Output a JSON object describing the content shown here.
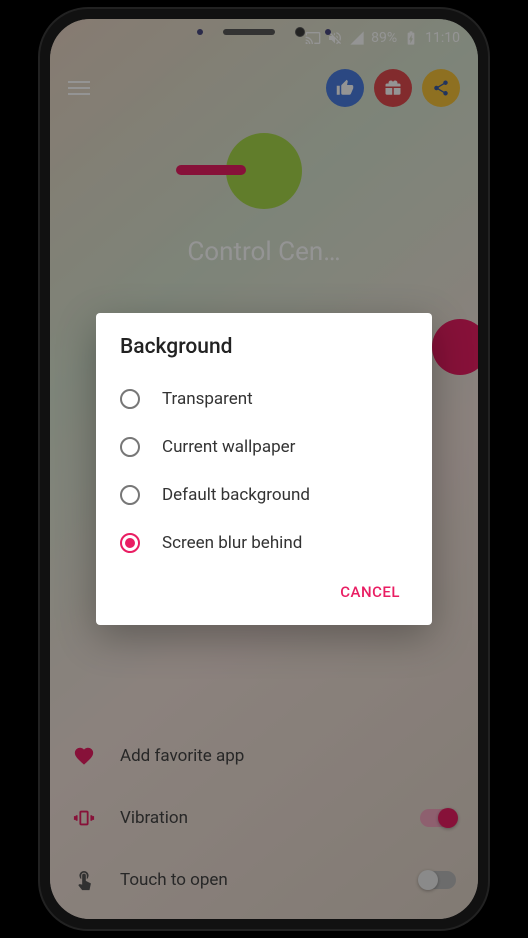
{
  "status": {
    "battery_pct": "89%",
    "time": "11:10"
  },
  "header": {
    "title": "Control Cen…"
  },
  "dialog": {
    "title": "Background",
    "options": [
      {
        "label": "Transparent",
        "selected": false
      },
      {
        "label": "Current wallpaper",
        "selected": false
      },
      {
        "label": "Default background",
        "selected": false
      },
      {
        "label": "Screen blur behind",
        "selected": true
      }
    ],
    "cancel": "CANCEL"
  },
  "list": {
    "items": [
      {
        "label": "Add favorite app",
        "icon": "heart",
        "toggle": null
      },
      {
        "label": "Vibration",
        "icon": "vibrate",
        "toggle": true
      },
      {
        "label": "Touch to open",
        "icon": "touch",
        "toggle": false
      }
    ]
  }
}
